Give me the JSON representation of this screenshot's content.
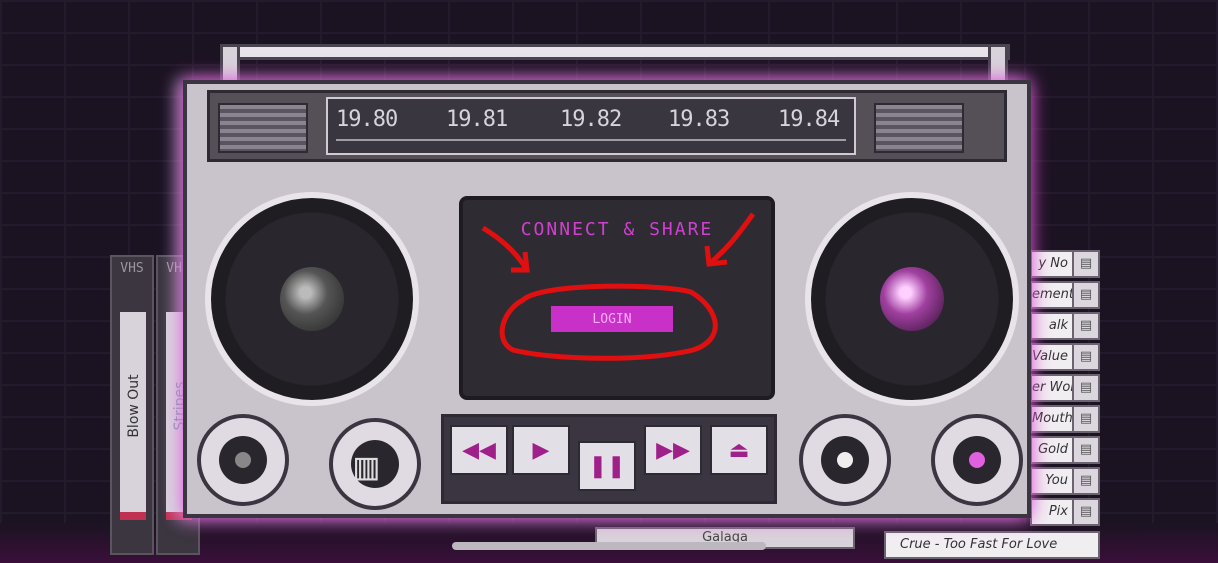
{
  "radio": {
    "frequencies": [
      "19.80",
      "19.81",
      "19.82",
      "19.83",
      "19.84"
    ]
  },
  "screen": {
    "title": "CONNECT & SHARE",
    "login_label": "LOGIN"
  },
  "controls": {
    "rewind": "◀◀",
    "play": "▶",
    "pause": "❚❚",
    "fast_forward": "▶▶",
    "eject": "⏏"
  },
  "vhs_tapes": [
    {
      "brand": "VHS",
      "title": "Blow Out"
    },
    {
      "brand": "VHS",
      "title": "Stripes"
    }
  ],
  "cassettes": [
    {
      "title": "y No"
    },
    {
      "title": "ement"
    },
    {
      "title": "alk"
    },
    {
      "title": "Value"
    },
    {
      "title": "er World"
    },
    {
      "title": "Mouth"
    },
    {
      "title": "Gold"
    },
    {
      "title": "You"
    },
    {
      "title": "Pix"
    }
  ],
  "bottom_tape": "Crue - Too Fast For Love",
  "galaga_tape": "Galaga",
  "colors": {
    "accent": "#d040d0",
    "annotation": "#e01010",
    "glow": "#e040d0"
  }
}
